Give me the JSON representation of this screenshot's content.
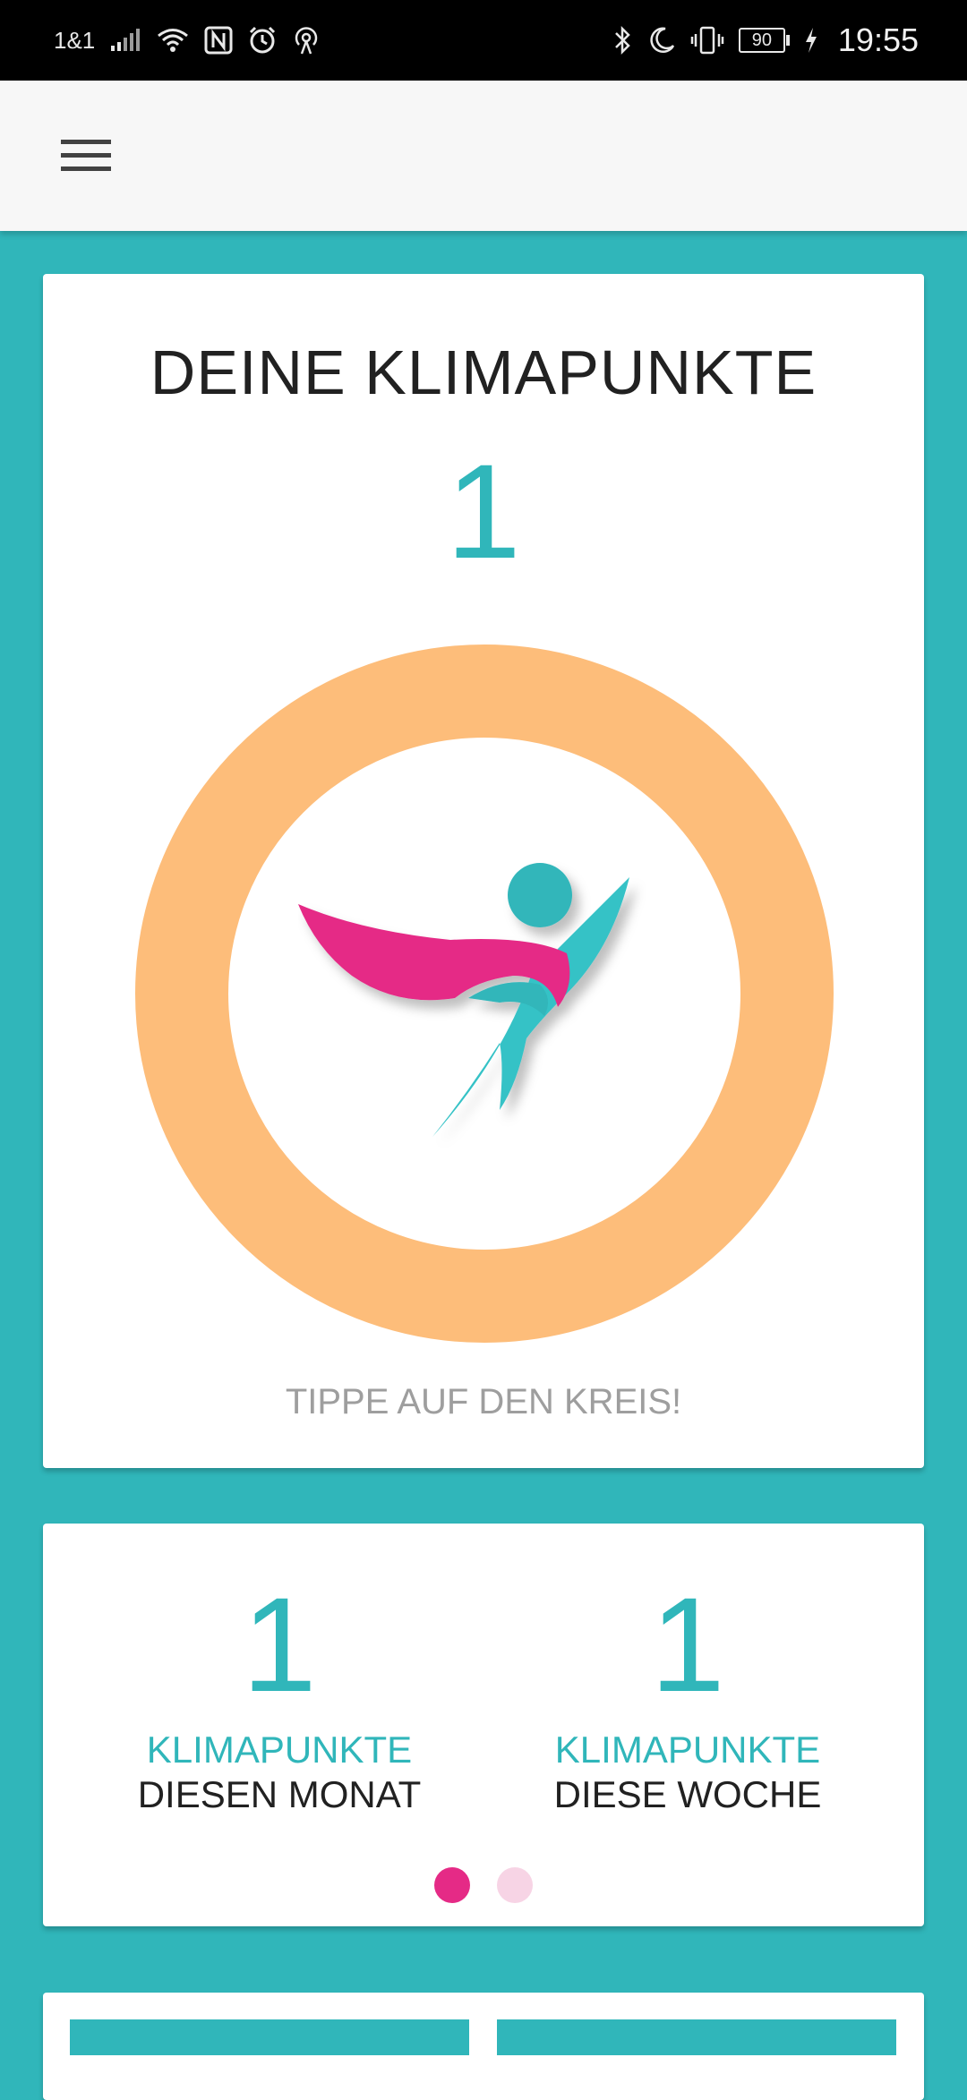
{
  "status_bar": {
    "carrier": "1&1",
    "battery": "90",
    "time": "19:55",
    "icons_left": [
      "signal-icon",
      "wifi-icon",
      "nfc-icon",
      "alarm-icon",
      "hotspot-icon"
    ],
    "icons_right": [
      "bluetooth-icon",
      "moon-icon",
      "vibrate-icon",
      "battery-icon",
      "charging-icon"
    ]
  },
  "app_bar": {
    "menu_icon": "hamburger-menu-icon"
  },
  "main_card": {
    "title": "DEINE KLIMAPUNKTE",
    "points": "1",
    "hint": "TIPPE AUF DEN KREIS!",
    "ring_color": "#fdbd7a",
    "logo_icon": "superhero-logo-icon"
  },
  "stats_card": {
    "left": {
      "value": "1",
      "label_line1": "KLIMAPUNKTE",
      "label_line2": "DIESEN MONAT"
    },
    "right": {
      "value": "1",
      "label_line1": "KLIMAPUNKTE",
      "label_line2": "DIESE WOCHE"
    },
    "pager": {
      "page_count": 2,
      "active_index": 0
    }
  },
  "colors": {
    "accent": "#30b6ba",
    "pink": "#e52a86",
    "pink_light": "#f7d4e5",
    "orange": "#fdbd7a",
    "text_dark": "#212121",
    "text_hint": "#9e9e9e"
  }
}
